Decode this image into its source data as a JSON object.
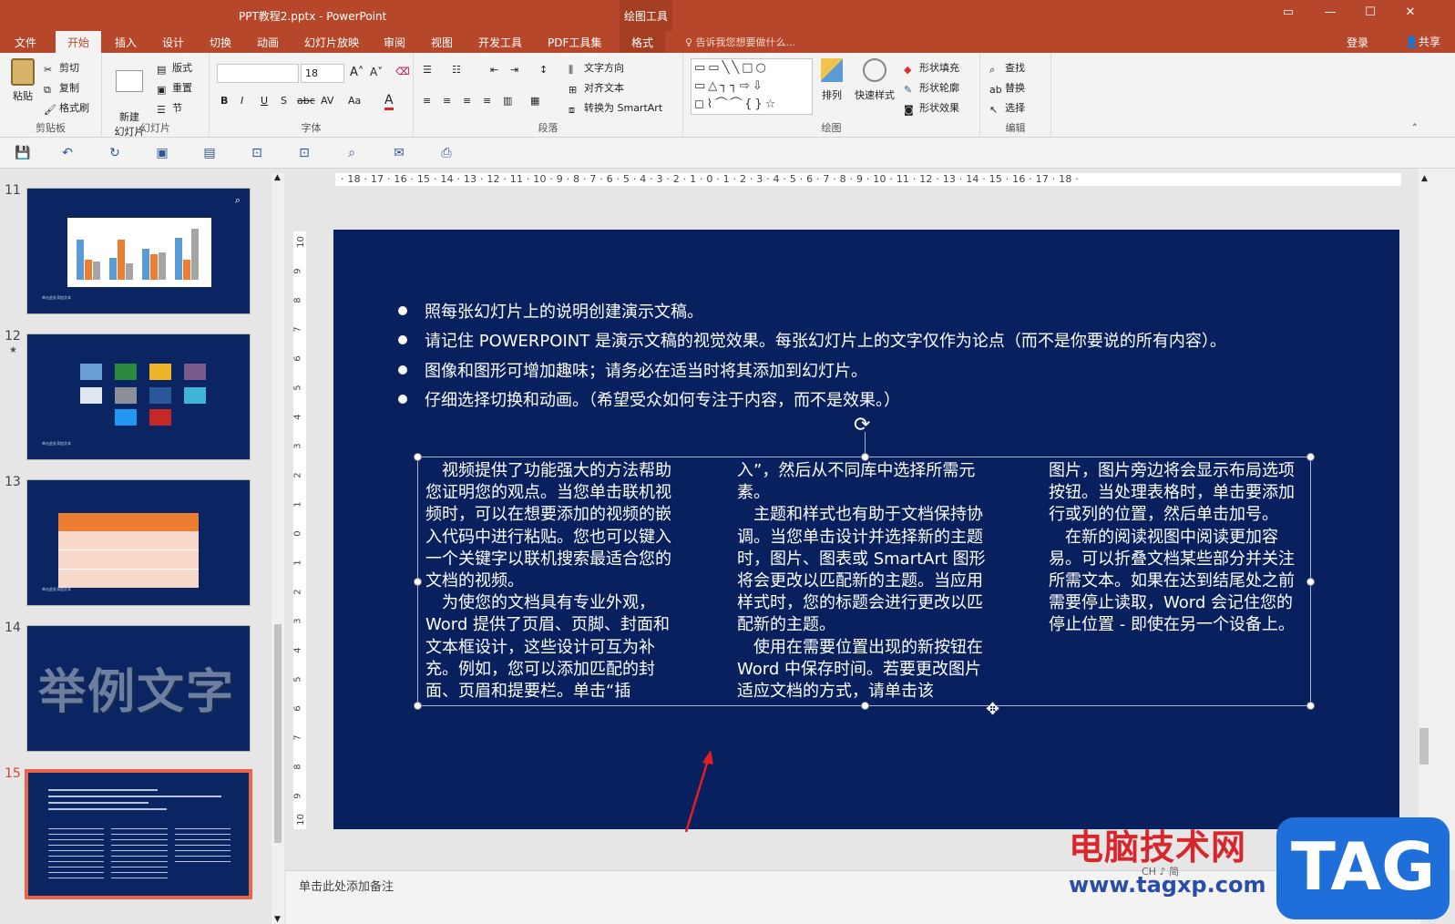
{
  "titlebar": {
    "title": "PPT教程2.pptx - PowerPoint",
    "context_tab": "绘图工具"
  },
  "tabs": [
    "文件",
    "开始",
    "插入",
    "设计",
    "切换",
    "动画",
    "幻灯片放映",
    "审阅",
    "视图",
    "开发工具",
    "PDF工具集",
    "格式"
  ],
  "tell_me": "告诉我您想要做什么...",
  "account": {
    "login": "登录",
    "share": "共享"
  },
  "ribbon": {
    "clipboard": {
      "paste": "粘贴",
      "cut": "剪切",
      "copy": "复制",
      "format_painter": "格式刷",
      "label": "剪贴板"
    },
    "slides": {
      "new_slide": "新建\n幻灯片",
      "layout": "版式",
      "reset": "重置",
      "section": "节",
      "label": "幻灯片"
    },
    "font": {
      "size": "18",
      "label": "字体"
    },
    "paragraph": {
      "text_direction": "文字方向",
      "align_text": "对齐文本",
      "smartart": "转换为 SmartArt",
      "label": "段落"
    },
    "drawing": {
      "arrange": "排列",
      "quick_styles": "快速样式",
      "fill": "形状填充",
      "outline": "形状轮廓",
      "effects": "形状效果",
      "label": "绘图"
    },
    "editing": {
      "find": "查找",
      "replace": "替换",
      "select": "选择",
      "label": "编辑"
    }
  },
  "ruler": {
    "h": "· 18 · 17 · 16 · 15 · 14 · 13 · 12 · 11 · 10 · 9 · 8 · 7 · 6 · 5 · 4 · 3 · 2 · 1 · 0 · 1 · 2 · 3 · 4 · 5 · 6 · 7 · 8 · 9 · 10 · 11 · 12 · 13 · 14 · 15 · 16 · 17 · 18 ·",
    "v": [
      "10",
      "9",
      "8",
      "7",
      "6",
      "5",
      "4",
      "3",
      "2",
      "1",
      "0",
      "1",
      "2",
      "3",
      "4",
      "5",
      "6",
      "7",
      "8",
      "9",
      "10"
    ]
  },
  "thumbnails": [
    {
      "num": "11",
      "caption": "单击此处添加文本"
    },
    {
      "num": "12",
      "caption": "单击此处添加文本"
    },
    {
      "num": "13",
      "caption": "单击此处添加文本"
    },
    {
      "num": "14",
      "caption": "举例文字"
    },
    {
      "num": "15",
      "caption": ""
    }
  ],
  "slide": {
    "bullets": [
      "照每张幻灯片上的说明创建演示文稿。",
      "请记住 POWERPOINT 是演示文稿的视觉效果。每张幻灯片上的文字仅作为论点（而不是你要说的所有内容）。",
      "图像和图形可增加趣味；请务必在适当时将其添加到幻灯片。",
      "仔细选择切换和动画。（希望受众如何专注于内容，而不是效果。）"
    ],
    "columns": [
      "　视频提供了功能强大的方法帮助您证明您的观点。当您单击联机视频时，可以在想要添加的视频的嵌入代码中进行粘贴。您也可以键入一个关键字以联机搜索最适合您的文档的视频。\n　为使您的文档具有专业外观，Word 提供了页眉、页脚、封面和文本框设计，这些设计可互为补充。例如，您可以添加匹配的封面、页眉和提要栏。单击“插",
      "入”，然后从不同库中选择所需元素。\n　主题和样式也有助于文档保持协调。当您单击设计并选择新的主题时，图片、图表或 SmartArt 图形将会更改以匹配新的主题。当应用样式时，您的标题会进行更改以匹配新的主题。\n　使用在需要位置出现的新按钮在 Word 中保存时间。若要更改图片适应文档的方式，请单击该",
      "图片，图片旁边将会显示布局选项按钮。当处理表格时，单击要添加行或列的位置，然后单击加号。\n　在新的阅读视图中阅读更加容易。可以折叠文档某些部分并关注所需文本。如果在达到结尾处之前需要停止读取，Word 会记住您的停止位置 - 即使在另一个设备上。"
    ]
  },
  "notes_placeholder": "单击此处添加备注",
  "watermark": {
    "site_cn": "电脑技术网",
    "site_url": "www.tagxp.com",
    "tag": "TAG",
    "ime": "CH ♪ 简"
  },
  "colors": {
    "accent": "#b7472a",
    "slide_bg": "#08215e"
  }
}
